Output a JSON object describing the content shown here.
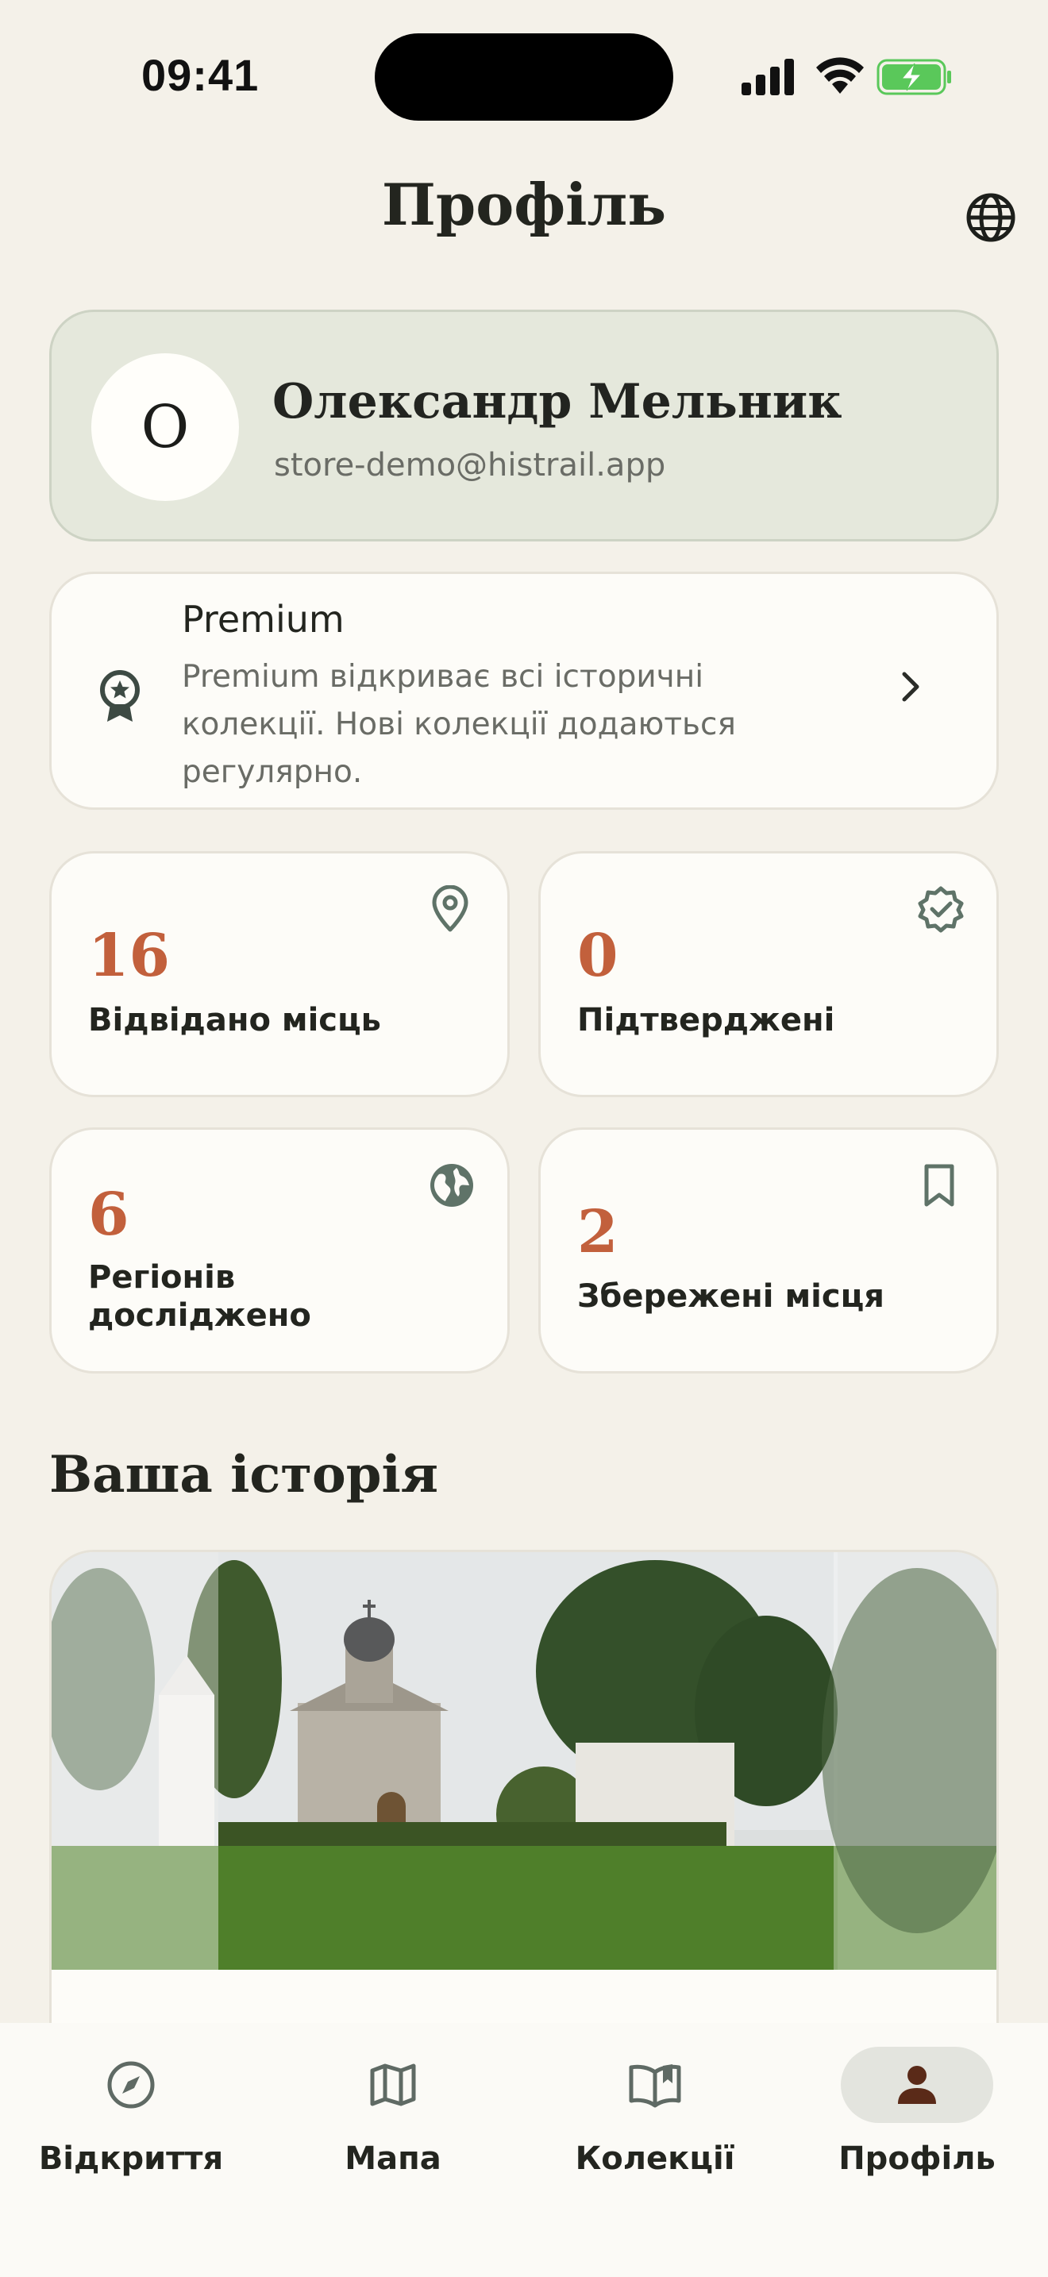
{
  "status_bar": {
    "time": "09:41",
    "icons": [
      "signal-icon",
      "wifi-icon",
      "battery-charging-icon"
    ]
  },
  "header": {
    "title": "Профіль",
    "language_icon": "globe-icon"
  },
  "profile": {
    "avatar_initial": "О",
    "name": "Олександр Мельник",
    "email": "store-demo@histrail.app"
  },
  "premium": {
    "icon": "award-badge-icon",
    "title": "Premium",
    "description": "Premium відкриває всі історичні колекції. Нові колекції додаються регулярно."
  },
  "stats": [
    {
      "value": "16",
      "label": "Відвідано місць",
      "icon": "map-pin-icon"
    },
    {
      "value": "0",
      "label": "Підтверджені",
      "icon": "verified-badge-icon"
    },
    {
      "value": "6",
      "label": "Регіонів досліджено",
      "icon": "globe-filled-icon"
    },
    {
      "value": "2",
      "label": "Збережені місця",
      "icon": "bookmark-icon"
    }
  ],
  "history": {
    "section_title": "Ваша історія"
  },
  "colors": {
    "background": "#f4f1e9",
    "accent": "#c2603c",
    "icon": "#5f7368",
    "profile_card": "#e5e8dc"
  },
  "tab_bar": {
    "items": [
      {
        "label": "Відкриття",
        "icon": "compass-icon",
        "active": false
      },
      {
        "label": "Мапа",
        "icon": "map-icon",
        "active": false
      },
      {
        "label": "Колекції",
        "icon": "book-open-icon",
        "active": false
      },
      {
        "label": "Профіль",
        "icon": "person-icon",
        "active": true
      }
    ]
  }
}
